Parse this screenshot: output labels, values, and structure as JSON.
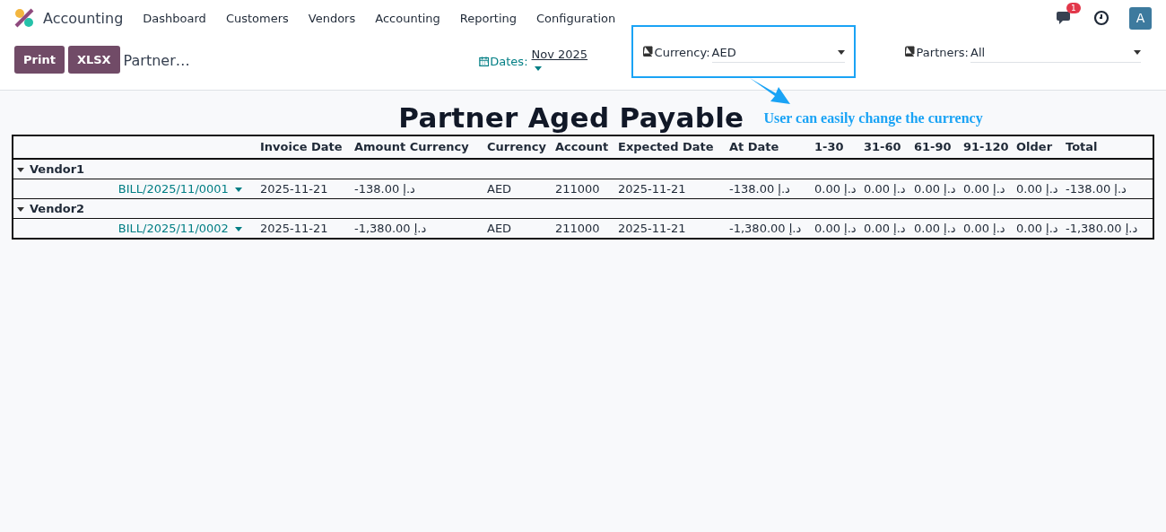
{
  "navbar": {
    "app_name": "Accounting",
    "menu": [
      "Dashboard",
      "Customers",
      "Vendors",
      "Accounting",
      "Reporting",
      "Configuration"
    ],
    "chat_badge": "1",
    "avatar": "A"
  },
  "toolbar": {
    "buttons": [
      "Print",
      "XLSX"
    ],
    "breadcrumb": "Partner…"
  },
  "filters": {
    "dates": {
      "label": "Dates:",
      "value": "Nov 2025"
    },
    "currency": {
      "label": "Currency:",
      "value": "AED",
      "highlighted": true
    },
    "partners": {
      "label": "Partners:",
      "value": "All"
    }
  },
  "report": {
    "title": "Partner Aged Payable",
    "annotation": "User can easily change the currency"
  },
  "table": {
    "columns": [
      "",
      "Invoice Date",
      "Amount Currency",
      "Currency",
      "Account",
      "Expected Date",
      "At Date",
      "1-30",
      "31-60",
      "61-90",
      "91-120",
      "Older",
      "Total"
    ],
    "groups": [
      {
        "name": "Vendor1",
        "expanded": true,
        "rows": [
          {
            "bill": "BILL/2025/11/0001",
            "cells": [
              "2025-11-21",
              "-138.00 د.إ",
              "AED",
              "211000",
              "2025-11-21",
              "-138.00 د.إ",
              "0.00 د.إ",
              "0.00 د.إ",
              "0.00 د.إ",
              "0.00 د.إ",
              "0.00 د.إ",
              "-138.00 د.إ"
            ]
          }
        ]
      },
      {
        "name": "Vendor2",
        "expanded": true,
        "rows": [
          {
            "bill": "BILL/2025/11/0002",
            "cells": [
              "2025-11-21",
              "-1,380.00 د.إ",
              "AED",
              "211000",
              "2025-11-21",
              "-1,380.00 د.إ",
              "0.00 د.إ",
              "0.00 د.إ",
              "0.00 د.إ",
              "0.00 د.إ",
              "0.00 د.إ",
              "-1,380.00 د.إ"
            ]
          }
        ]
      }
    ]
  }
}
